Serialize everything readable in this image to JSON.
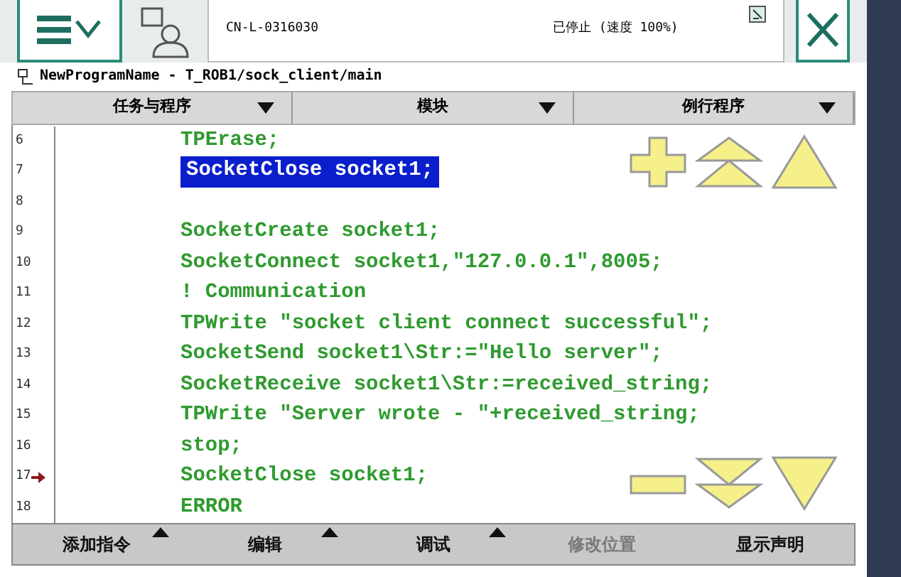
{
  "status": {
    "controller": "CN-L-0316030",
    "state": "已停止 (速度 100%)"
  },
  "path": "NewProgramName - T_ROB1/sock_client/main",
  "tabs": [
    {
      "label": "任务与程序"
    },
    {
      "label": "模块"
    },
    {
      "label": "例行程序"
    }
  ],
  "code": [
    {
      "line": "6",
      "text": "TPErase;",
      "selected": false,
      "pointer": false
    },
    {
      "line": "7",
      "text": "SocketClose socket1;",
      "selected": true,
      "pointer": false
    },
    {
      "line": "8",
      "selected": false,
      "pointer": false
    },
    {
      "line": "9",
      "text": "SocketCreate socket1;",
      "selected": false,
      "pointer": false
    },
    {
      "line": "10",
      "text": "SocketConnect socket1,\"127.0.0.1\",8005;",
      "selected": false,
      "pointer": false
    },
    {
      "line": "11",
      "text": "! Communication",
      "selected": false,
      "pointer": false
    },
    {
      "line": "12",
      "text": "TPWrite \"socket client connect successful\";",
      "selected": false,
      "pointer": false
    },
    {
      "line": "13",
      "text": "SocketSend socket1\\Str:=\"Hello server\";",
      "selected": false,
      "pointer": false
    },
    {
      "line": "14",
      "text": "SocketReceive socket1\\Str:=received_string;",
      "selected": false,
      "pointer": false
    },
    {
      "line": "15",
      "text": "TPWrite \"Server wrote - \"+received_string;",
      "selected": false,
      "pointer": false
    },
    {
      "line": "16",
      "text": "stop;",
      "selected": false,
      "pointer": false
    },
    {
      "line": "17",
      "text": "SocketClose socket1;",
      "selected": false,
      "pointer": true
    },
    {
      "line": "18",
      "text": "ERROR",
      "selected": false,
      "pointer": false
    }
  ],
  "buttons": [
    {
      "label": "添加指令",
      "menu": true,
      "disabled": false
    },
    {
      "label": "编辑",
      "menu": true,
      "disabled": false
    },
    {
      "label": "调试",
      "menu": true,
      "disabled": false
    },
    {
      "label": "修改位置",
      "menu": false,
      "disabled": true
    },
    {
      "label": "显示声明",
      "menu": false,
      "disabled": false
    }
  ]
}
